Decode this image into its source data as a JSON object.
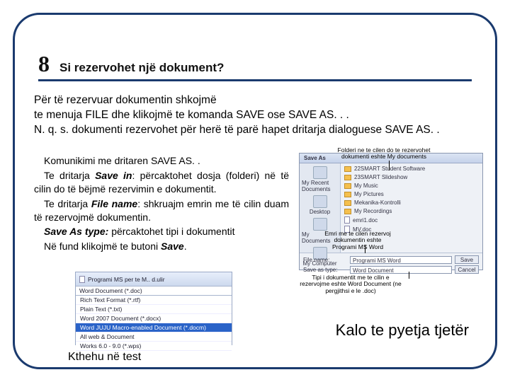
{
  "heading": {
    "number": "8",
    "title": "Si rezervohet një dokument?"
  },
  "intro": {
    "l1": "Për të rezervuar dokumentin shkojmë",
    "l2": "te menuja FILE dhe klikojmë te komanda SAVE ose SAVE AS. . .",
    "l3": "N. q. s. dokumenti rezervohet për herë të parë hapet dritarja dialoguese SAVE AS. ."
  },
  "explain": {
    "p1": "Komunikimi me dritaren SAVE AS. .",
    "p2a": "Te dritarja ",
    "p2b": "Save in",
    "p2c": ": përcaktohet dosja (folderi) në të cilin do të bëjmë rezervimin e dokumentit.",
    "p3a": "Te dritarja ",
    "p3b": "File name",
    "p3c": ": shkruajm emrin me të cilin duam të rezervojmë dokumentin.",
    "p4a": "Save As type:",
    "p4b": " përcaktohet tipi i dokumentit",
    "p5a": "Në fund klikojmë te butoni ",
    "p5b": "Save",
    "p5c": "."
  },
  "dialog": {
    "title": "Save As",
    "side": [
      "My Recent Documents",
      "Desktop",
      "My Documents",
      "My Computer"
    ],
    "items": [
      "22SMART Student Software",
      "23SMART Slideshow",
      "My Music",
      "My Pictures",
      "Mekanika-Kontrolli",
      "My Recordings",
      "emri1.doc",
      "MV.doc"
    ],
    "filename_label": "File name:",
    "filename_value": "Programi MS Word",
    "type_label": "Save as type:",
    "type_value": "Word Document",
    "save": "Save",
    "cancel": "Cancel"
  },
  "annotations": {
    "a1": "Folderi ne te cilen do te rezervohet dokumenti eshte My documents",
    "a2": "Emri me te cilen rezervoj dokumentin eshte Programi MS Word",
    "a3": "Tipi i dokumentit me te cilin e rezervojme eshte Word Document (ne pergjithsi e le .doc)"
  },
  "dropdown": {
    "head": "Programi MS per te M.. d.ulir",
    "top": "Word Document (*.doc)",
    "items": [
      "Rich Text Format (*.rtf)",
      "Plain Text (*.txt)",
      "Word 2007 Document (*.docx)",
      "Word JUJU Macro-enabled Document (*.docm)",
      "All web & Document",
      "Works 6.0 - 9.0 (*.wps)"
    ]
  },
  "nav": {
    "next": "Kalo te pyetja tjetër",
    "back": "Kthehu në test"
  }
}
